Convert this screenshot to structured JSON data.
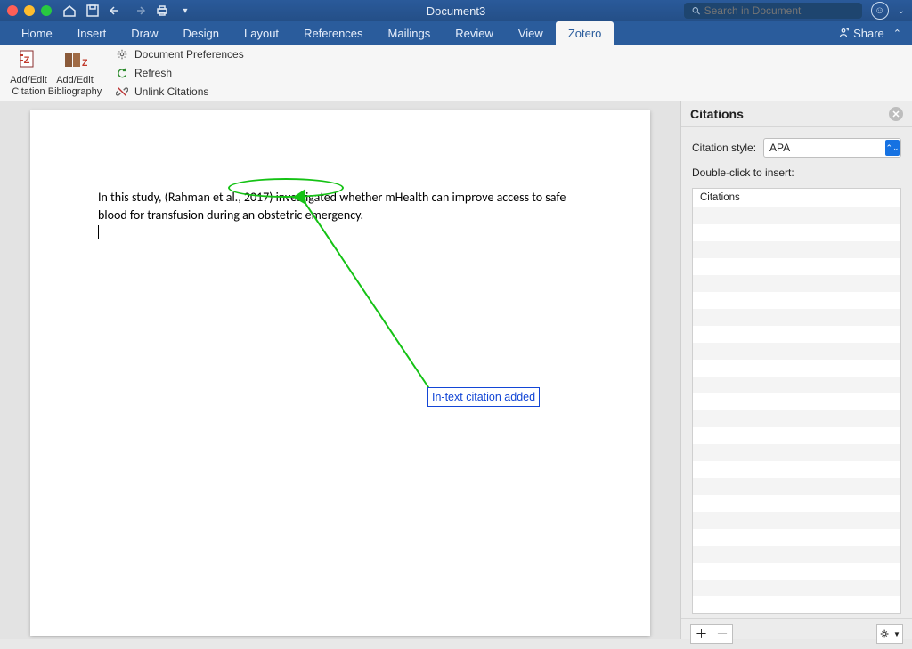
{
  "title": "Document3",
  "search": {
    "placeholder": "Search in Document"
  },
  "tabs": {
    "items": [
      {
        "label": "Home"
      },
      {
        "label": "Insert"
      },
      {
        "label": "Draw"
      },
      {
        "label": "Design"
      },
      {
        "label": "Layout"
      },
      {
        "label": "References"
      },
      {
        "label": "Mailings"
      },
      {
        "label": "Review"
      },
      {
        "label": "View"
      },
      {
        "label": "Zotero",
        "active": true
      }
    ],
    "share": "Share"
  },
  "toolbar": {
    "addEditCitation": {
      "line1": "Add/Edit",
      "line2": "Citation"
    },
    "addEditBibliography": {
      "line1": "Add/Edit",
      "line2": "Bibliography"
    },
    "docPrefs": "Document Preferences",
    "refresh": "Refresh",
    "unlinkCitations": "Unlink Citations"
  },
  "document": {
    "body_pre": "In this study, ",
    "citation": "(Rahman et al., 2017)",
    "body_post": " investigated whether mHealth can improve access to safe blood for transfusion during an obstetric emergency."
  },
  "annotation": {
    "label": "In-text citation added"
  },
  "panel": {
    "title": "Citations",
    "styleLabel": "Citation style:",
    "styleValue": "APA",
    "insertHint": "Double-click to insert:",
    "tableHeader": "Citations"
  }
}
